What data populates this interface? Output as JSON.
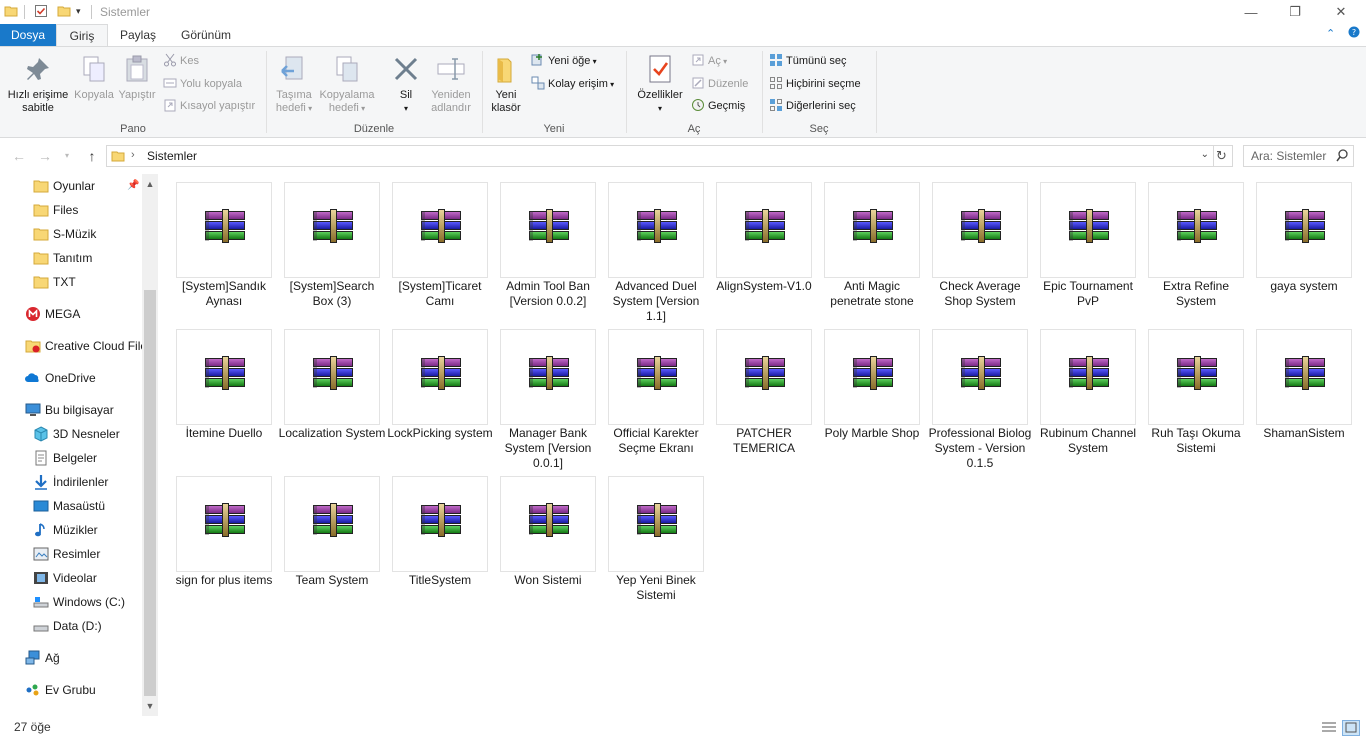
{
  "window": {
    "title": "Sistemler",
    "minimize_glyph": "—",
    "maximize_glyph": "❐",
    "close_glyph": "✕"
  },
  "ribbon_tabs": {
    "file": "Dosya",
    "home": "Giriş",
    "share": "Paylaş",
    "view": "Görünüm"
  },
  "ribbon": {
    "clipboard": {
      "label": "Pano",
      "pin_line1": "Hızlı erişime",
      "pin_line2": "sabitle",
      "copy": "Kopyala",
      "paste": "Yapıştır",
      "cut": "Kes",
      "copy_path": "Yolu kopyala",
      "paste_shortcut": "Kısayol yapıştır"
    },
    "organize": {
      "label": "Düzenle",
      "move_line1": "Taşıma",
      "move_line2": "hedefi",
      "copyto_line1": "Kopyalama",
      "copyto_line2": "hedefi",
      "delete": "Sil",
      "rename_line1": "Yeniden",
      "rename_line2": "adlandır"
    },
    "new": {
      "label": "Yeni",
      "new_folder_line1": "Yeni",
      "new_folder_line2": "klasör",
      "new_item": "Yeni öğe",
      "easy_access": "Kolay erişim"
    },
    "open": {
      "label": "Aç",
      "properties": "Özellikler",
      "open": "Aç",
      "edit": "Düzenle",
      "history": "Geçmiş"
    },
    "select": {
      "label": "Seç",
      "select_all": "Tümünü seç",
      "select_none": "Hiçbirini seçme",
      "invert": "Diğerlerini seç"
    }
  },
  "address": {
    "crumb": "Sistemler",
    "search_placeholder": "Ara: Sistemler"
  },
  "nav": {
    "quick": [
      "Oyunlar",
      "Files",
      "S-Müzik",
      "Tanıtım",
      "TXT"
    ],
    "mega": "MEGA",
    "creative_cloud": "Creative Cloud Files",
    "onedrive": "OneDrive",
    "this_pc": "Bu bilgisayar",
    "pc_items": [
      "3D Nesneler",
      "Belgeler",
      "İndirilenler",
      "Masaüstü",
      "Müzikler",
      "Resimler",
      "Videolar",
      "Windows (C:)",
      "Data (D:)"
    ],
    "network": "Ağ",
    "homegroup": "Ev Grubu"
  },
  "files": [
    "[System]Sandık Aynası",
    "[System]Search Box (3)",
    "[System]Ticaret Camı",
    "Admin Tool Ban [Version 0.0.2]",
    "Advanced Duel System [Version 1.1]",
    "AlignSystem-V1.0",
    "Anti Magic penetrate stone",
    "Check Average Shop System",
    "Epic Tournament PvP",
    "Extra Refine System",
    "gaya system",
    "İtemine Duello",
    "Localization System",
    "LockPicking system",
    "Manager Bank System [Version 0.0.1]",
    "Official Karekter Seçme Ekranı",
    "PATCHER TEMERICA",
    "Poly Marble Shop",
    "Professional Biolog System - Version 0.1.5",
    "Rubinum Channel System",
    "Ruh Taşı Okuma Sistemi",
    "ShamanSistem",
    "sign for plus items",
    "Team System",
    "TitleSystem",
    "Won Sistemi",
    "Yep Yeni Binek Sistemi"
  ],
  "status": {
    "count": "27 öğe"
  },
  "colors": {
    "accent": "#1979ca",
    "ribbon_bg": "#f5f6f7",
    "folder": "#f8d775"
  }
}
